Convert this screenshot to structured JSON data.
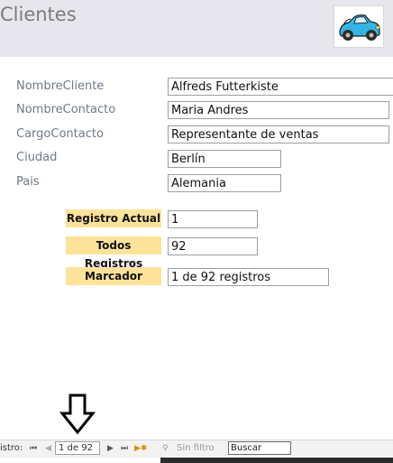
{
  "form": {
    "title": "Clientes",
    "logo_icon": "car-icon"
  },
  "fields": [
    {
      "label": "NombreCliente",
      "value": "Alfreds Futterkiste"
    },
    {
      "label": "NombreContacto",
      "value": "Maria Andres"
    },
    {
      "label": "CargoContacto",
      "value": "Representante de ventas"
    },
    {
      "label": "Ciudad",
      "value": "Berlín"
    },
    {
      "label": "Pais",
      "value": "Alemania"
    }
  ],
  "summary": {
    "registro_actual": {
      "label": "Registro Actual",
      "value": "1"
    },
    "todos_registros": {
      "label": "Todos Registros",
      "value": "92"
    },
    "marcador": {
      "label": "Marcador",
      "value": "1 de 92 registros"
    }
  },
  "navigation": {
    "prefix": "istro:",
    "position": "1 de 92",
    "filter_label": "Sin filtro",
    "search_value": "Buscar"
  },
  "colors": {
    "highlight": "#fde39a",
    "header_bg": "#e6e6ec"
  }
}
